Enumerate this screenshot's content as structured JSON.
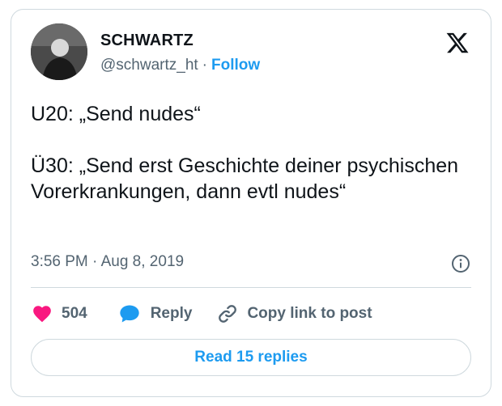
{
  "author": {
    "name": "SCHWARTZ",
    "handle": "@schwartz_ht",
    "separator": "·",
    "follow_label": "Follow"
  },
  "tweet": {
    "text": "U20: „Send nudes“\n\nÜ30: „Send erst Geschichte deiner psychischen Vorerkrankungen, dann evtl nudes“",
    "timestamp": "3:56 PM · Aug 8, 2019"
  },
  "actions": {
    "likes": "504",
    "reply_label": "Reply",
    "copy_link_label": "Copy link to post"
  },
  "footer": {
    "read_replies_label": "Read 15 replies"
  },
  "icons": {
    "brand": "x-logo-icon",
    "info": "info-icon",
    "like": "heart-icon",
    "reply": "speech-bubble-icon",
    "copy": "link-icon"
  },
  "colors": {
    "accent": "#1d9bf0",
    "like": "#f91880",
    "muted": "#536471",
    "border": "#cfd9de"
  }
}
